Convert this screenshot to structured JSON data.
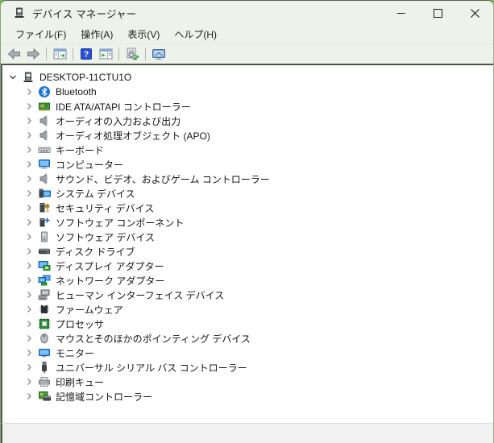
{
  "window": {
    "title": "デバイス マネージャー"
  },
  "menu": {
    "items": [
      {
        "name": "file",
        "label": "ファイル(F)"
      },
      {
        "name": "action",
        "label": "操作(A)"
      },
      {
        "name": "view",
        "label": "表示(V)"
      },
      {
        "name": "help",
        "label": "ヘルプ(H)"
      }
    ]
  },
  "toolbar": {
    "buttons": [
      {
        "name": "back",
        "icon": "arrow-left-icon",
        "enabled": false
      },
      {
        "name": "forward",
        "icon": "arrow-right-icon",
        "enabled": false
      },
      {
        "type": "separator"
      },
      {
        "name": "show-hide-console-tree",
        "icon": "console-tree-icon",
        "enabled": true
      },
      {
        "type": "separator"
      },
      {
        "name": "help",
        "icon": "help-icon",
        "enabled": true
      },
      {
        "name": "show-hide-action-pane",
        "icon": "action-pane-icon",
        "enabled": true
      },
      {
        "type": "separator"
      },
      {
        "name": "scan-hardware-changes",
        "icon": "scan-hardware-icon",
        "enabled": true
      },
      {
        "type": "separator"
      },
      {
        "name": "remote-computer",
        "icon": "computer-mgmt-icon",
        "enabled": true
      }
    ]
  },
  "tree": {
    "root": {
      "name": "desktop-11ctu1o",
      "label": "DESKTOP-11CTU1O",
      "icon": "computer-root",
      "expanded": true
    },
    "children": [
      {
        "name": "bluetooth",
        "label": "Bluetooth",
        "icon": "bluetooth"
      },
      {
        "name": "ide-ata-atapi-controllers",
        "label": "IDE ATA/ATAPI コントローラー",
        "icon": "ide-controller"
      },
      {
        "name": "audio-inputs-outputs",
        "label": "オーディオの入力および出力",
        "icon": "audio-endpoint"
      },
      {
        "name": "audio-processing-objects",
        "label": "オーディオ処理オブジェクト (APO)",
        "icon": "audio-endpoint"
      },
      {
        "name": "keyboards",
        "label": "キーボード",
        "icon": "keyboard"
      },
      {
        "name": "computer",
        "label": "コンピューター",
        "icon": "computer"
      },
      {
        "name": "sound-video-game",
        "label": "サウンド、ビデオ、およびゲーム コントローラー",
        "icon": "audio-endpoint"
      },
      {
        "name": "system-devices",
        "label": "システム デバイス",
        "icon": "system-device"
      },
      {
        "name": "security-devices",
        "label": "セキュリティ デバイス",
        "icon": "security-device"
      },
      {
        "name": "software-components",
        "label": "ソフトウェア コンポーネント",
        "icon": "software-component"
      },
      {
        "name": "software-devices",
        "label": "ソフトウェア デバイス",
        "icon": "software-device"
      },
      {
        "name": "disk-drives",
        "label": "ディスク ドライブ",
        "icon": "disk-drive"
      },
      {
        "name": "display-adapters",
        "label": "ディスプレイ アダプター",
        "icon": "display-adapter"
      },
      {
        "name": "network-adapters",
        "label": "ネットワーク アダプター",
        "icon": "network-adapter"
      },
      {
        "name": "human-interface-devices",
        "label": "ヒューマン インターフェイス デバイス",
        "icon": "hid"
      },
      {
        "name": "firmware",
        "label": "ファームウェア",
        "icon": "firmware"
      },
      {
        "name": "processors",
        "label": "プロセッサ",
        "icon": "processor"
      },
      {
        "name": "mice-pointing-devices",
        "label": "マウスとそのほかのポインティング デバイス",
        "icon": "mouse"
      },
      {
        "name": "monitors",
        "label": "モニター",
        "icon": "monitor"
      },
      {
        "name": "usb-controllers",
        "label": "ユニバーサル シリアル バス コントローラー",
        "icon": "usb-controller"
      },
      {
        "name": "print-queues",
        "label": "印刷キュー",
        "icon": "print-queue"
      },
      {
        "name": "storage-controllers",
        "label": "記憶域コントローラー",
        "icon": "storage-controller"
      }
    ]
  },
  "status_bar": {
    "text": ""
  },
  "colors": {
    "desktop_background": "#79b65c",
    "chrome_background": "#edf3ea",
    "content_background": "#ffffff",
    "status_background": "#f1f1f1",
    "help_icon_blue": "#2b4fd0",
    "device_green": "#3d9c40",
    "monitor_blue": "#2f8fe8"
  }
}
